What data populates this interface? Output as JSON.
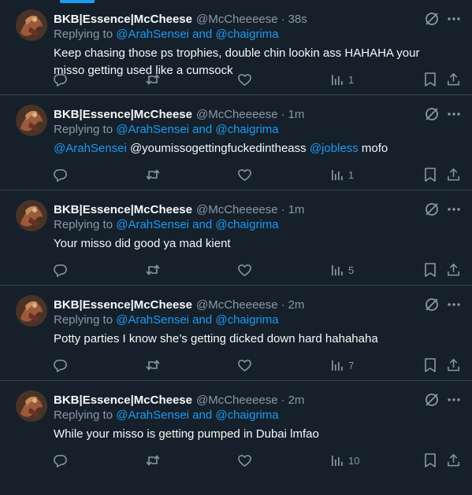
{
  "icons": {
    "reply": "speech-bubble-icon",
    "retweet": "retweet-arrows-icon",
    "like": "heart-icon",
    "views": "bar-chart-icon",
    "bookmark": "bookmark-icon",
    "share": "upload-share-icon",
    "no_interest": "circle-slash-icon",
    "more": "ellipsis-icon"
  },
  "colors": {
    "background": "#15202b",
    "accent": "#1d9bf0",
    "muted": "#8b98a5",
    "divider": "#38444d"
  },
  "tweets": [
    {
      "display_name": "BKB|Essence|McCheese",
      "handle": "@McCheeeese",
      "separator": "·",
      "time": "38s",
      "replying_prefix": "Replying to",
      "replying_users": "@ArahSensei and @chaigrima",
      "text_parts": [
        {
          "text": "Keep chasing those ps trophies, double chin lookin ass HAHAHA your misso getting used like a cumsock",
          "link": false
        }
      ],
      "views": "1"
    },
    {
      "display_name": "BKB|Essence|McCheese",
      "handle": "@McCheeeese",
      "separator": "·",
      "time": "1m",
      "replying_prefix": "Replying to",
      "replying_users": "@ArahSensei and @chaigrima",
      "text_parts": [
        {
          "text": "@ArahSensei",
          "link": true
        },
        {
          "text": " @youmissogettingfuckedintheass ",
          "link": false
        },
        {
          "text": "@jobless",
          "link": true
        },
        {
          "text": " mofo",
          "link": false
        }
      ],
      "views": "1"
    },
    {
      "display_name": "BKB|Essence|McCheese",
      "handle": "@McCheeeese",
      "separator": "·",
      "time": "1m",
      "replying_prefix": "Replying to",
      "replying_users": "@ArahSensei and @chaigrima",
      "text_parts": [
        {
          "text": "Your misso did good ya mad kient",
          "link": false
        }
      ],
      "views": "5"
    },
    {
      "display_name": "BKB|Essence|McCheese",
      "handle": "@McCheeeese",
      "separator": "·",
      "time": "2m",
      "replying_prefix": "Replying to",
      "replying_users": "@ArahSensei and @chaigrima",
      "text_parts": [
        {
          "text": "Potty parties I know she’s getting dicked down hard hahahaha",
          "link": false
        }
      ],
      "views": "7"
    },
    {
      "display_name": "BKB|Essence|McCheese",
      "handle": "@McCheeeese",
      "separator": "·",
      "time": "2m",
      "replying_prefix": "Replying to",
      "replying_users": "@ArahSensei and @chaigrima",
      "text_parts": [
        {
          "text": "While your misso is getting pumped in Dubai lmfao",
          "link": false
        }
      ],
      "views": "10"
    }
  ]
}
